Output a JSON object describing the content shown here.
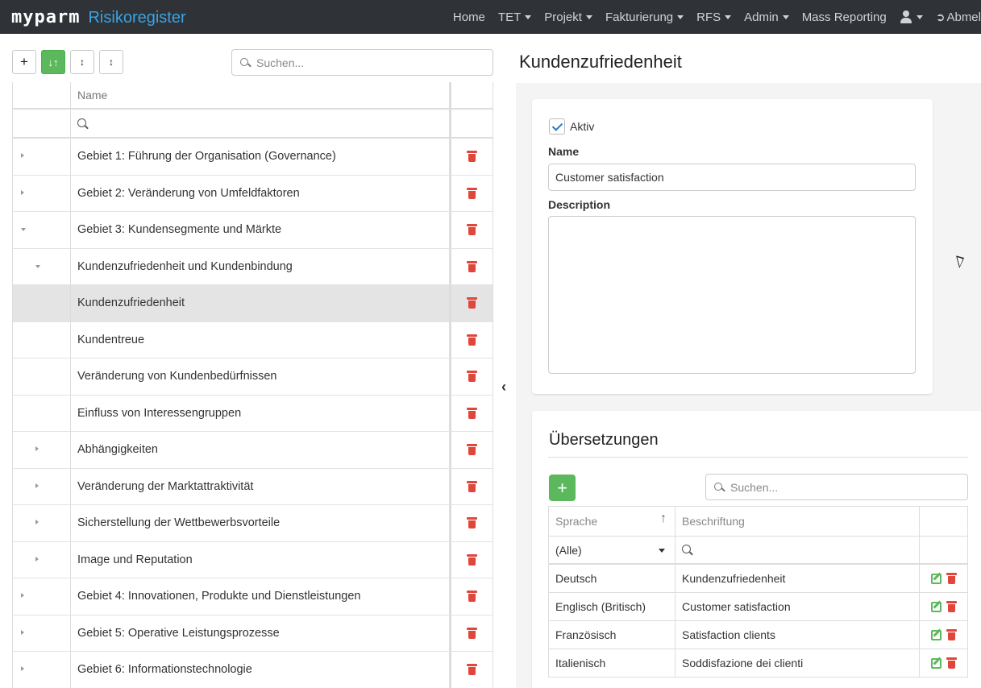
{
  "app": {
    "logo": "myparm",
    "module": "Risikoregister"
  },
  "nav": {
    "home": "Home",
    "tet": "TET",
    "projekt": "Projekt",
    "fakturierung": "Fakturierung",
    "rfs": "RFS",
    "admin": "Admin",
    "mass_reporting": "Mass Reporting",
    "logout": "Abmel"
  },
  "tree": {
    "search_placeholder": "Suchen...",
    "column_name": "Name",
    "rows": [
      {
        "label": "Gebiet 1: Führung der Organisation (Governance)",
        "level": 0,
        "state": "collapsed"
      },
      {
        "label": "Gebiet 2: Veränderung von Umfeldfaktoren",
        "level": 0,
        "state": "collapsed"
      },
      {
        "label": "Gebiet 3: Kundensegmente und Märkte",
        "level": 0,
        "state": "expanded"
      },
      {
        "label": "Kundenzufriedenheit und Kundenbindung",
        "level": 1,
        "state": "expanded"
      },
      {
        "label": "Kundenzufriedenheit",
        "level": 2,
        "state": "leaf",
        "selected": true
      },
      {
        "label": "Kundentreue",
        "level": 2,
        "state": "leaf"
      },
      {
        "label": "Veränderung von Kundenbedürfnissen",
        "level": 2,
        "state": "leaf"
      },
      {
        "label": "Einfluss von Interessengruppen",
        "level": 2,
        "state": "leaf"
      },
      {
        "label": "Abhängigkeiten",
        "level": 1,
        "state": "collapsed"
      },
      {
        "label": "Veränderung der Marktattraktivität",
        "level": 1,
        "state": "collapsed"
      },
      {
        "label": "Sicherstellung der Wettbewerbsvorteile",
        "level": 1,
        "state": "collapsed"
      },
      {
        "label": "Image und Reputation",
        "level": 1,
        "state": "collapsed"
      },
      {
        "label": "Gebiet 4: Innovationen, Produkte und Dienstleistungen",
        "level": 0,
        "state": "collapsed"
      },
      {
        "label": "Gebiet 5: Operative Leistungsprozesse",
        "level": 0,
        "state": "collapsed"
      },
      {
        "label": "Gebiet 6: Informationstechnologie",
        "level": 0,
        "state": "collapsed"
      }
    ]
  },
  "detail": {
    "title": "Kundenzufriedenheit",
    "active_label": "Aktiv",
    "active": true,
    "name_label": "Name",
    "name_value": "Customer satisfaction",
    "description_label": "Description",
    "description_value": ""
  },
  "translations": {
    "title": "Übersetzungen",
    "search_placeholder": "Suchen...",
    "col_language": "Sprache",
    "col_caption": "Beschriftung",
    "filter_language": "(Alle)",
    "rows": [
      {
        "language": "Deutsch",
        "caption": "Kundenzufriedenheit"
      },
      {
        "language": "Englisch (Britisch)",
        "caption": "Customer satisfaction"
      },
      {
        "language": "Französisch",
        "caption": "Satisfaction clients"
      },
      {
        "language": "Italienisch",
        "caption": "Soddisfazione dei clienti"
      }
    ]
  },
  "colors": {
    "navbar": "#2f3337",
    "accent": "#3aa3e3",
    "green": "#5cb85c",
    "red": "#e0463a"
  }
}
